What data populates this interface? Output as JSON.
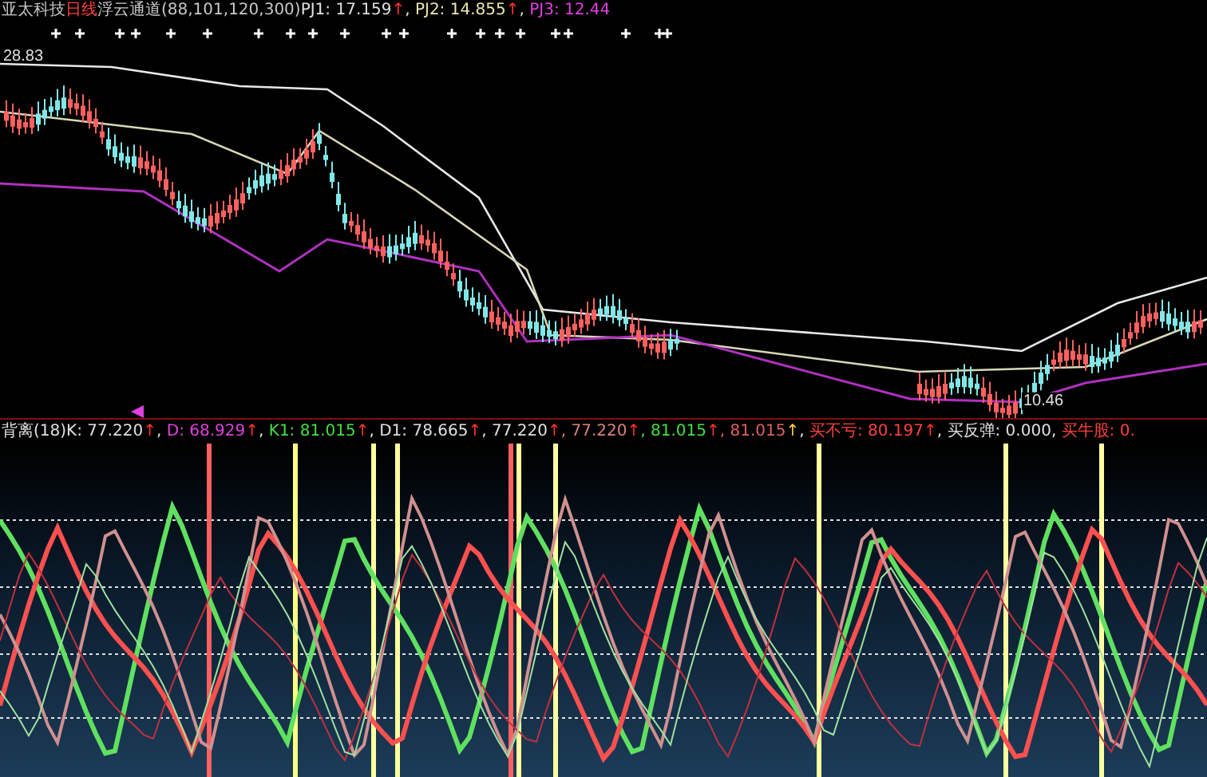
{
  "main_legend": [
    {
      "text": "亚太科技",
      "color": "#c8c8c8"
    },
    {
      "text": "日线",
      "color": "#ff4040"
    },
    {
      "text": "浮云通道(88,101,120,300)",
      "color": "#c8c8c8"
    },
    {
      "text": "PJ1: 17.159",
      "color": "#e0e0e0"
    },
    {
      "text": "↑",
      "color": "#ff3030"
    },
    {
      "text": ", PJ2: 14.855",
      "color": "#e8e8b0"
    },
    {
      "text": "↑",
      "color": "#ff3030"
    },
    {
      "text": ", ",
      "color": "#e0e0e0"
    },
    {
      "text": "PJ3: 12.44",
      "color": "#e040e0"
    }
  ],
  "price_labels": [
    "28.83",
    "10.46"
  ],
  "indicator_legend": [
    {
      "text": "背离(18)",
      "color": "#e0e0e0"
    },
    {
      "text": "K: 77.220",
      "color": "#e0e0e0"
    },
    {
      "text": "↑",
      "color": "#ff3030"
    },
    {
      "text": ", ",
      "color": "#e0e0e0"
    },
    {
      "text": "D: 68.929",
      "color": "#e040e0"
    },
    {
      "text": "↑",
      "color": "#ff3030"
    },
    {
      "text": ", ",
      "color": "#e0e0e0"
    },
    {
      "text": "K1: 81.015",
      "color": "#40e040"
    },
    {
      "text": "↑",
      "color": "#ff3030"
    },
    {
      "text": ", D1: 78.665",
      "color": "#e0e0e0"
    },
    {
      "text": "↑",
      "color": "#ff3030"
    },
    {
      "text": ", 77.220",
      "color": "#e0e0e0"
    },
    {
      "text": "↑",
      "color": "#ff3030"
    },
    {
      "text": ", 77.220",
      "color": "#e08080"
    },
    {
      "text": "↑",
      "color": "#ff3030"
    },
    {
      "text": ", 81.015",
      "color": "#40e040"
    },
    {
      "text": "↑",
      "color": "#ff3030"
    },
    {
      "text": ", 81.015",
      "color": "#e06060"
    },
    {
      "text": "↑",
      "color": "#ffd040"
    },
    {
      "text": ", ",
      "color": "#e0e0e0"
    },
    {
      "text": "买不亏: 80.197",
      "color": "#ff4040"
    },
    {
      "text": "↑",
      "color": "#ff3030"
    },
    {
      "text": ", 买反弹: 0.000, ",
      "color": "#e0e0e0"
    },
    {
      "text": "买牛股: 0.",
      "color": "#ff4040"
    }
  ]
}
